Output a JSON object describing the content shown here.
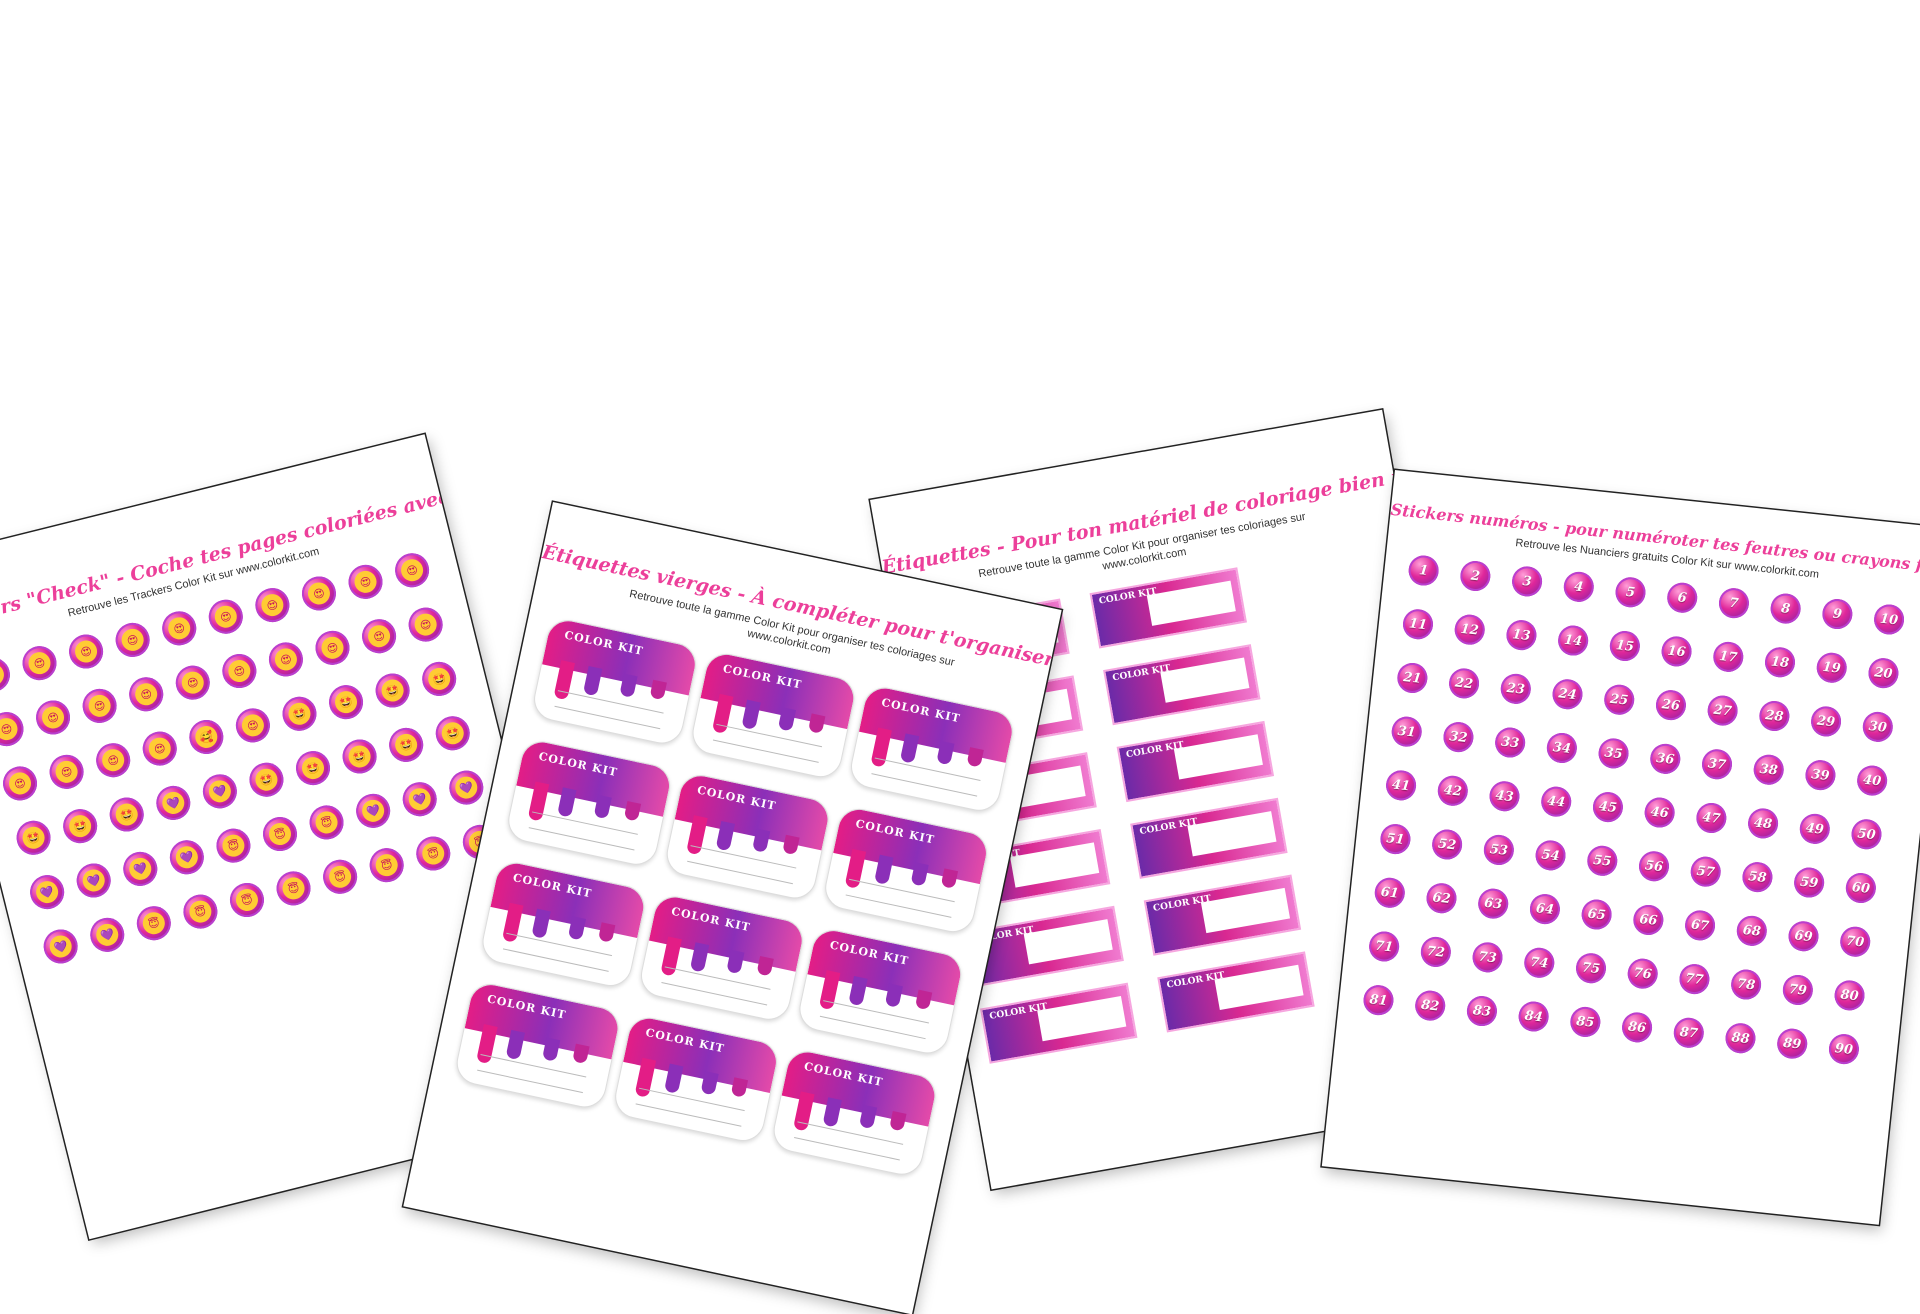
{
  "sheet1": {
    "title": "Stickers \"Check\" - Coche tes pages coloriées avec style!",
    "subtitle": "Retrouve les Trackers Color Kit sur www.colorkit.com",
    "emojis": [
      "😍",
      "😍",
      "😍",
      "😍",
      "😍",
      "😍",
      "😍",
      "😍",
      "😍",
      "😍",
      "😍",
      "😍",
      "😍",
      "😍",
      "😍",
      "😍",
      "😍",
      "😍",
      "😍",
      "😍",
      "😍",
      "😍",
      "😍",
      "😍",
      "🥰",
      "😍",
      "🤩",
      "🤩",
      "🤩",
      "🤩",
      "🤩",
      "🤩",
      "🤩",
      "💜",
      "💜",
      "🤩",
      "🤩",
      "🤩",
      "🤩",
      "🤩",
      "💜",
      "💜",
      "💜",
      "💜",
      "😇",
      "😇",
      "😇",
      "💜",
      "💜",
      "💜",
      "💜",
      "💜",
      "😇",
      "😇",
      "😇",
      "😇",
      "😇",
      "😇",
      "😇",
      "😇"
    ]
  },
  "sheet2": {
    "title": "Étiquettes vierges - À compléter pour t'organiser avec style",
    "subtitle1": "Retrouve toute la gamme Color Kit pour organiser tes coloriages sur",
    "subtitle2": "www.colorkit.com",
    "brand": "COLOR KIT"
  },
  "sheet3": {
    "title": "Étiquettes - Pour ton matériel de coloriage bien rangé",
    "subtitle1": "Retrouve toute la gamme Color Kit pour organiser tes coloriages sur",
    "subtitle2": "www.colorkit.com",
    "brand": "COLOR KIT"
  },
  "sheet4": {
    "title": "Stickers numéros - pour numéroter tes feutres ou crayons facilement!",
    "subtitle": "Retrouve les Nuanciers gratuits Color Kit sur www.colorkit.com",
    "numbers": [
      "1",
      "2",
      "3",
      "4",
      "5",
      "6",
      "7",
      "8",
      "9",
      "10",
      "11",
      "12",
      "13",
      "14",
      "15",
      "16",
      "17",
      "18",
      "19",
      "20",
      "21",
      "22",
      "23",
      "24",
      "25",
      "26",
      "27",
      "28",
      "29",
      "30",
      "31",
      "32",
      "33",
      "34",
      "35",
      "36",
      "37",
      "38",
      "39",
      "40",
      "41",
      "42",
      "43",
      "44",
      "45",
      "46",
      "47",
      "48",
      "49",
      "50",
      "51",
      "52",
      "53",
      "54",
      "55",
      "56",
      "57",
      "58",
      "59",
      "60",
      "61",
      "62",
      "63",
      "64",
      "65",
      "66",
      "67",
      "68",
      "69",
      "70",
      "71",
      "72",
      "73",
      "74",
      "75",
      "76",
      "77",
      "78",
      "79",
      "80",
      "81",
      "82",
      "83",
      "84",
      "85",
      "86",
      "87",
      "88",
      "89",
      "90"
    ]
  },
  "colors": {
    "accent": "#ec3f9a",
    "purple": "#7a1fa5",
    "pink": "#e0279a"
  }
}
